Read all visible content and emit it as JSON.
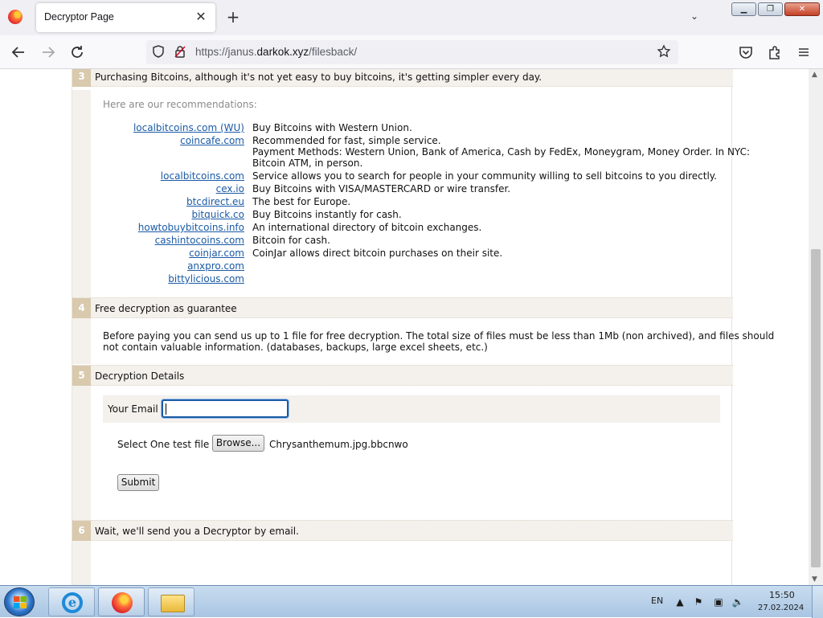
{
  "browser": {
    "tab_title": "Decryptor Page",
    "tab_close": "✕",
    "new_tab": "+",
    "tab_list": "⌄",
    "url_prefix": "https://janus.",
    "url_domain": "darkok.xyz",
    "url_path": "/filesback/",
    "win_min": "▁",
    "win_max": "❐",
    "win_close": "✕"
  },
  "sections": {
    "s3": {
      "number": "3",
      "title": "Purchasing Bitcoins, although it's not yet easy to buy bitcoins, it's getting simpler every day.",
      "intro": "Here are our recommendations:",
      "exchanges": [
        {
          "name": "localbitcoins.com (WU)",
          "desc": "Buy Bitcoins with Western Union."
        },
        {
          "name": "coincafe.com",
          "desc": "Recommended for fast, simple service.",
          "desc2": "Payment Methods: Western Union, Bank of America, Cash by FedEx, Moneygram, Money Order. In NYC:",
          "desc3": "Bitcoin ATM, in person."
        },
        {
          "name": "localbitcoins.com",
          "desc": "Service allows you to search for people in your community willing to sell bitcoins to you directly."
        },
        {
          "name": "cex.io",
          "desc": "Buy Bitcoins with VISA/MASTERCARD or wire transfer."
        },
        {
          "name": "btcdirect.eu",
          "desc": "The best for Europe."
        },
        {
          "name": "bitquick.co",
          "desc": "Buy Bitcoins instantly for cash."
        },
        {
          "name": "howtobuybitcoins.info",
          "desc": "An international directory of bitcoin exchanges."
        },
        {
          "name": "cashintocoins.com",
          "desc": "Bitcoin for cash."
        },
        {
          "name": "coinjar.com",
          "desc": "CoinJar allows direct bitcoin purchases on their site."
        },
        {
          "name": "anxpro.com",
          "desc": ""
        },
        {
          "name": "bittylicious.com",
          "desc": ""
        }
      ]
    },
    "s4": {
      "number": "4",
      "title": "Free decryption as guarantee",
      "line1": "Before paying you can send us up to 1 file for free decryption. The total size of files must be less than 1Mb (non archived), and files should",
      "line2": "not contain valuable information. (databases, backups, large excel sheets, etc.)"
    },
    "s5": {
      "number": "5",
      "title": "Decryption Details",
      "email_label": "Your Email :",
      "email_value": "",
      "file_label": "Select One test file :",
      "browse_label": "Browse...",
      "file_name": "Chrysanthemum.jpg.bbcnwo",
      "submit_label": "Submit"
    },
    "s6": {
      "number": "6",
      "title": "Wait, we'll send you a Decryptor by email."
    }
  },
  "taskbar": {
    "language": "EN",
    "time": "15:50",
    "date": "27.02.2024"
  },
  "icons": {
    "back": "firefox-back-icon",
    "forward": "firefox-forward-icon",
    "reload": "reload-icon",
    "shield": "tracking-shield-icon",
    "lock": "lock-icon",
    "bookmark": "bookmark-star-icon",
    "pocket": "pocket-icon",
    "extensions": "extensions-icon",
    "menu": "hamburger-menu-icon"
  }
}
